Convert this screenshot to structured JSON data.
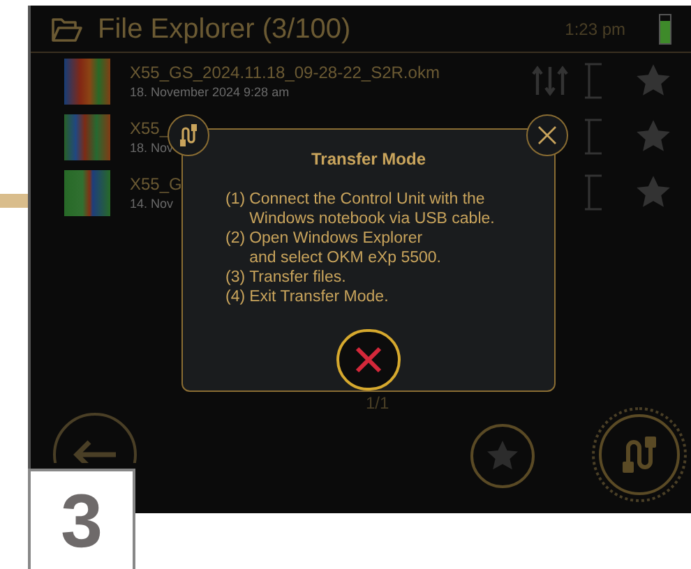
{
  "header": {
    "title": "File Explorer (3/100)",
    "time": "1:23 pm",
    "battery": {
      "level": 0.8
    }
  },
  "files": [
    {
      "name": "X55_GS_2024.11.18_09-28-22_S2R.okm",
      "date": "18. November 2024 9:28 am",
      "sort_icon": true
    },
    {
      "name": "X55_",
      "date": "18. Nov",
      "sort_icon": false
    },
    {
      "name": "X55_G",
      "date": "14. Nov",
      "sort_icon": false
    }
  ],
  "pagination": "1/1",
  "dialog": {
    "title": "Transfer Mode",
    "steps": [
      {
        "number": "(1)",
        "text": "Connect the Control Unit with the\nWindows notebook via USB cable."
      },
      {
        "number": "(2)",
        "text": "Open Windows Explorer\nand select OKM eXp 5500."
      },
      {
        "number": "(3)",
        "text": "Transfer files."
      },
      {
        "number": "(4)",
        "text": "Exit Transfer Mode."
      }
    ]
  },
  "step_label": "3"
}
